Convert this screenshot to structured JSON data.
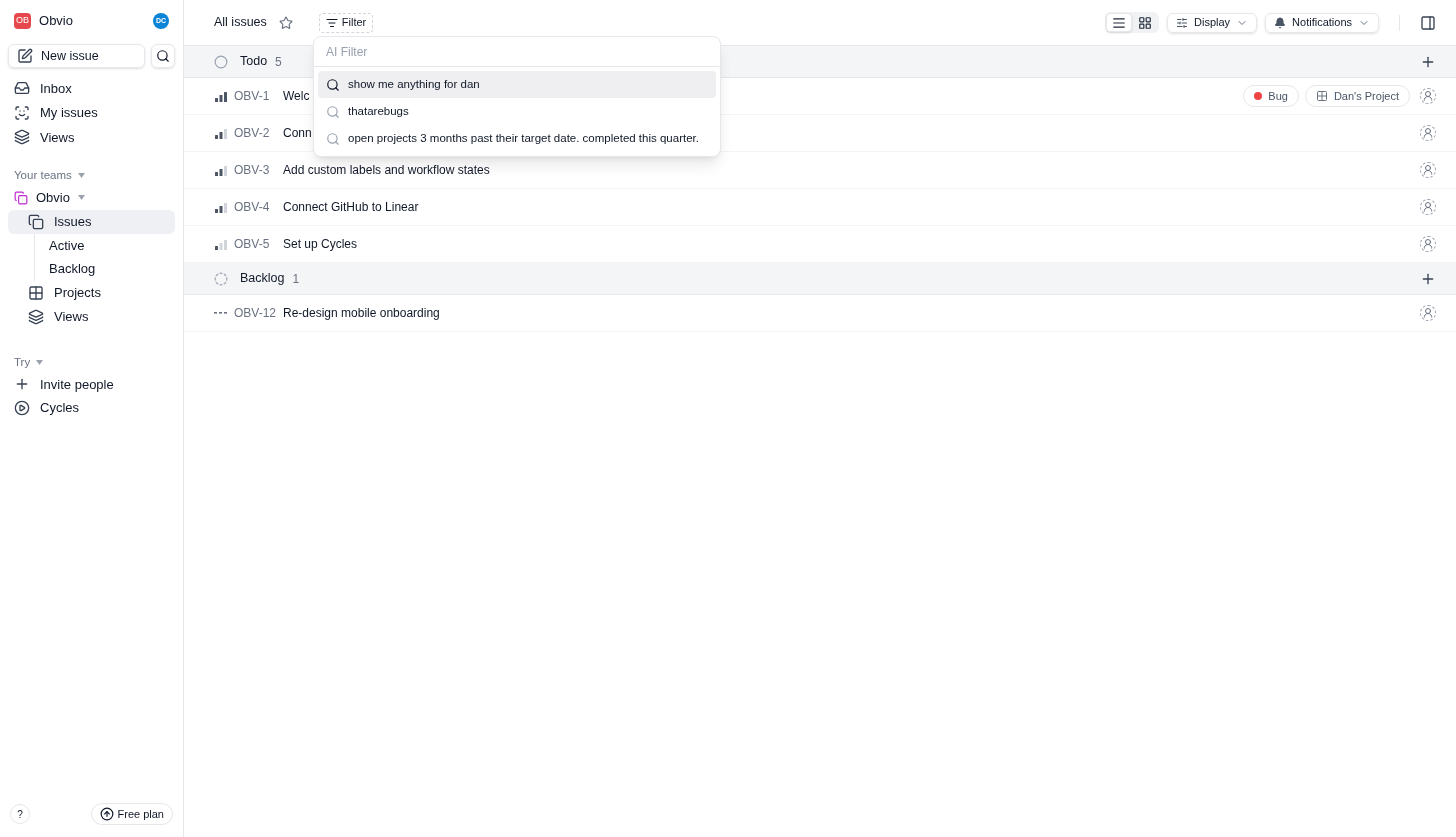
{
  "workspace": {
    "badge": "OB",
    "name": "Obvio",
    "avatar": "DC"
  },
  "sidebar": {
    "new_issue": "New issue",
    "items": [
      {
        "label": "Inbox",
        "kind": "inbox"
      },
      {
        "label": "My issues",
        "kind": "focus"
      },
      {
        "label": "Views",
        "kind": "layers"
      }
    ],
    "teams_heading": "Your teams",
    "team": {
      "name": "Obvio",
      "items": [
        {
          "label": "Issues",
          "kind": "issues",
          "selected": true,
          "children": [
            {
              "label": "Active",
              "selected": false
            },
            {
              "label": "Backlog",
              "selected": false
            }
          ]
        },
        {
          "label": "Projects",
          "kind": "grid",
          "selected": false
        },
        {
          "label": "Views",
          "kind": "layers",
          "selected": false
        }
      ]
    },
    "try_heading": "Try",
    "try_items": [
      {
        "label": "Invite people",
        "kind": "plus"
      },
      {
        "label": "Cycles",
        "kind": "cycle"
      }
    ],
    "help": "?",
    "plan": "Free plan"
  },
  "header": {
    "title": "All issues",
    "filter": "Filter",
    "view_modes": [
      {
        "kind": "list",
        "selected": true
      },
      {
        "kind": "board",
        "selected": false
      }
    ],
    "display": "Display",
    "notifications": "Notifications"
  },
  "filter_menu": {
    "placeholder": "AI Filter",
    "suggestions": [
      {
        "label": "show me anything for dan",
        "selected": true
      },
      {
        "label": "thatarebugs",
        "selected": false
      },
      {
        "label": "open projects 3 months past their target date. completed this quarter.",
        "selected": false
      }
    ]
  },
  "groups": [
    {
      "name": "Todo",
      "count": "5",
      "kind": "todo",
      "issues": [
        {
          "id": "OBV-1",
          "title": "Welc",
          "kind": "high",
          "labels": [
            {
              "kind": "dot",
              "text": "Bug",
              "color": "#ef4444"
            },
            {
              "kind": "project",
              "text": "Dan's Project"
            }
          ]
        },
        {
          "id": "OBV-2",
          "title": "Conn",
          "kind": "medium"
        },
        {
          "id": "OBV-3",
          "title": "Add custom labels and workflow states",
          "kind": "medium"
        },
        {
          "id": "OBV-4",
          "title": "Connect GitHub to Linear",
          "kind": "medium"
        },
        {
          "id": "OBV-5",
          "title": "Set up Cycles",
          "kind": "low"
        }
      ]
    },
    {
      "name": "Backlog",
      "count": "1",
      "kind": "backlog",
      "issues": [
        {
          "id": "OBV-12",
          "title": "Re-design mobile onboarding",
          "kind": "none"
        }
      ]
    }
  ]
}
